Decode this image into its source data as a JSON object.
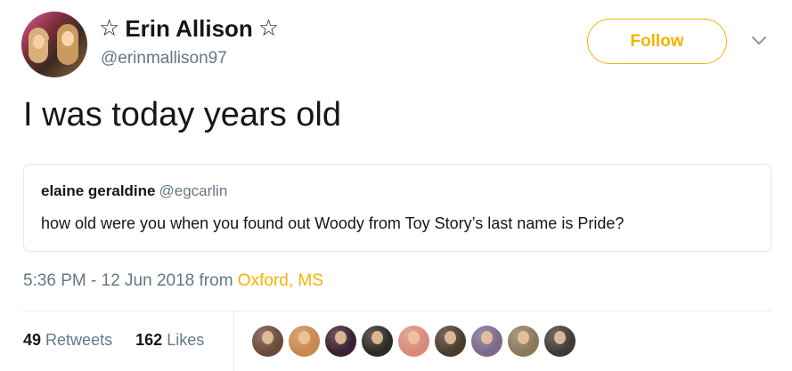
{
  "user": {
    "star_left": "☆",
    "display_name": "Erin Allison",
    "star_right": "☆",
    "handle": "@erinmallison97",
    "follow_label": "Follow"
  },
  "tweet": {
    "text": "I was today years old"
  },
  "quote": {
    "name": "elaine geraldine",
    "handle": "@egcarlin",
    "text": "how old were you when you found out Woody from Toy Story’s last name is Pride?"
  },
  "meta": {
    "time_date": "5:36 PM - 12 Jun 2018 from ",
    "location": "Oxford, MS"
  },
  "stats": {
    "retweets_count": "49",
    "retweets_label": "Retweets",
    "likes_count": "162",
    "likes_label": "Likes"
  },
  "colors": {
    "accent": "#f4b400",
    "secondary_text": "#657786",
    "border": "#e1e8ed"
  },
  "liker_avatars": [
    {
      "color": "#6b4a3a"
    },
    {
      "color": "#c9884e"
    },
    {
      "color": "#3a2030"
    },
    {
      "color": "#2e2a24"
    },
    {
      "color": "#d98a78"
    },
    {
      "color": "#4a3b2e"
    },
    {
      "color": "#7c6a8a"
    },
    {
      "color": "#8a7a5a"
    },
    {
      "color": "#3f3a34"
    }
  ]
}
